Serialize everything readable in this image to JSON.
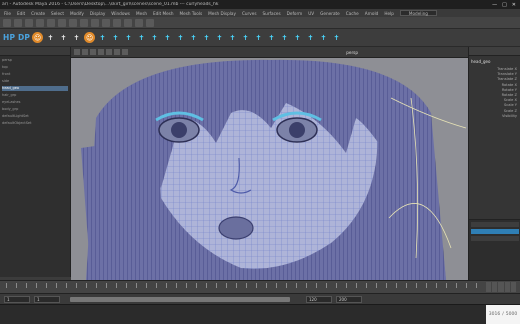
{
  "window": {
    "title": "ar\\ - Autodesk Maya 2016 - C:\\Users\\Desktop\\...\\skirt_girl\\scenes\\scene_01.mb  ---  curlyheads_hk",
    "controls": [
      "—",
      "□",
      "✕"
    ]
  },
  "menubar": {
    "items": [
      "File",
      "Edit",
      "Create",
      "Select",
      "Modify",
      "Display",
      "Windows",
      "Mesh",
      "Edit Mesh",
      "Mesh Tools",
      "Mesh Display",
      "Curves",
      "Surfaces",
      "Deform",
      "UV",
      "Generate",
      "Cache",
      "Arnold",
      "Help"
    ],
    "workspace": "Modeling"
  },
  "shelf": {
    "logo": "HP DP",
    "buttons": [
      {
        "icon": "face-icon",
        "glyph": "☺",
        "style": "orange"
      },
      {
        "icon": "joint-icon",
        "glyph": "✝",
        "style": "white"
      },
      {
        "icon": "joint-icon",
        "glyph": "✝",
        "style": "white"
      },
      {
        "icon": "joint-icon",
        "glyph": "✝",
        "style": "white"
      },
      {
        "icon": "face-icon",
        "glyph": "☺",
        "style": "orange"
      },
      {
        "icon": "skeleton-icon",
        "glyph": "✝",
        "style": "rig"
      },
      {
        "icon": "skeleton-icon",
        "glyph": "✝",
        "style": "rig"
      },
      {
        "icon": "skeleton-icon",
        "glyph": "✝",
        "style": "rig"
      },
      {
        "icon": "skeleton-icon",
        "glyph": "✝",
        "style": "rig"
      },
      {
        "icon": "skeleton-icon",
        "glyph": "✝",
        "style": "rig"
      },
      {
        "icon": "skeleton-icon",
        "glyph": "✝",
        "style": "rig"
      },
      {
        "icon": "skeleton-icon",
        "glyph": "✝",
        "style": "rig"
      },
      {
        "icon": "skeleton-icon",
        "glyph": "✝",
        "style": "rig"
      },
      {
        "icon": "skeleton-icon",
        "glyph": "✝",
        "style": "rig"
      },
      {
        "icon": "skeleton-icon",
        "glyph": "✝",
        "style": "rig"
      },
      {
        "icon": "skeleton-icon",
        "glyph": "✝",
        "style": "rig"
      },
      {
        "icon": "skeleton-icon",
        "glyph": "✝",
        "style": "rig"
      },
      {
        "icon": "skeleton-icon",
        "glyph": "✝",
        "style": "rig"
      },
      {
        "icon": "skeleton-icon",
        "glyph": "✝",
        "style": "rig"
      },
      {
        "icon": "skeleton-icon",
        "glyph": "✝",
        "style": "rig"
      },
      {
        "icon": "skeleton-icon",
        "glyph": "✝",
        "style": "rig"
      },
      {
        "icon": "skeleton-icon",
        "glyph": "✝",
        "style": "rig"
      },
      {
        "icon": "skeleton-icon",
        "glyph": "✝",
        "style": "rig"
      },
      {
        "icon": "skeleton-icon",
        "glyph": "✝",
        "style": "rig"
      }
    ]
  },
  "outliner": {
    "items": [
      "persp",
      "top",
      "front",
      "side",
      "head_geo",
      "hair_grp",
      "eyeLashes",
      "body_grp",
      "defaultLightSet",
      "defaultObjectSet"
    ],
    "selected_index": 4
  },
  "viewport": {
    "camera": "persp",
    "mesh_color": "#7f8fd8",
    "background": "#8f8f94",
    "hair_color": "#3a3e74"
  },
  "channel_box": {
    "object_name": "head_geo",
    "attributes": [
      "Translate X",
      "Translate Y",
      "Translate Z",
      "Rotate X",
      "Rotate Y",
      "Rotate Z",
      "Scale X",
      "Scale Y",
      "Scale Z",
      "Visibility"
    ]
  },
  "range": {
    "start": "1",
    "end": "120",
    "anim_start": "1",
    "anim_end": "200"
  },
  "page_indicator": {
    "current": "3016",
    "total": "5000",
    "separator": "/"
  }
}
